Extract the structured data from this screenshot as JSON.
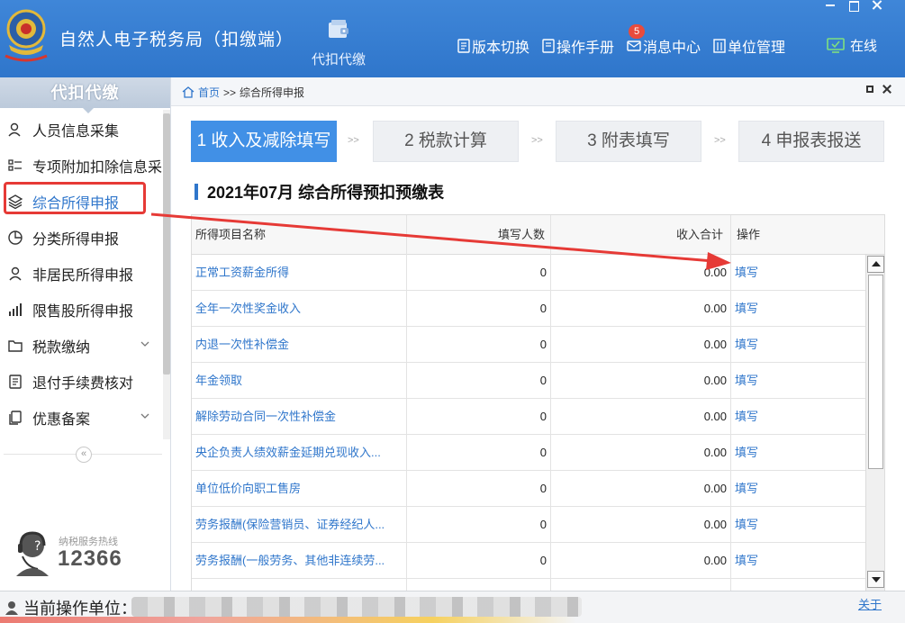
{
  "app": {
    "title": "自然人电子税务局（扣缴端）",
    "center_tab": "代扣代缴",
    "nav_links": [
      {
        "label": "版本切换",
        "icon": "document-icon"
      },
      {
        "label": "操作手册",
        "icon": "manual-icon"
      },
      {
        "label": "消息中心",
        "icon": "mail-icon",
        "badge": "5"
      },
      {
        "label": "单位管理",
        "icon": "building-icon"
      }
    ],
    "status": "在线"
  },
  "sidebar": {
    "header": "代扣代缴",
    "items": [
      {
        "label": "人员信息采集",
        "icon": "person-icon",
        "name": "sidebar-item-personnel"
      },
      {
        "label": "专项附加扣除信息采集",
        "icon": "list-icon",
        "name": "sidebar-item-special-deduction"
      },
      {
        "label": "综合所得申报",
        "icon": "layers-icon",
        "name": "sidebar-item-comprehensive",
        "active": true
      },
      {
        "label": "分类所得申报",
        "icon": "pie-icon",
        "name": "sidebar-item-classified"
      },
      {
        "label": "非居民所得申报",
        "icon": "person-icon",
        "name": "sidebar-item-nonresident"
      },
      {
        "label": "限售股所得申报",
        "icon": "bar-chart-icon",
        "name": "sidebar-item-restricted-shares"
      },
      {
        "label": "税款缴纳",
        "icon": "folder-icon",
        "name": "sidebar-item-tax-payment",
        "expandable": true
      },
      {
        "label": "退付手续费核对",
        "icon": "receipt-icon",
        "name": "sidebar-item-refund-fee"
      },
      {
        "label": "优惠备案",
        "icon": "copy-icon",
        "name": "sidebar-item-preferential",
        "expandable": true
      }
    ],
    "hotline_label": "纳税服务热线",
    "hotline_number": "12366"
  },
  "breadcrumb": {
    "home": "首页",
    "separator": ">>",
    "current": "综合所得申报"
  },
  "steps": [
    {
      "label": "1 收入及减除填写",
      "active": true
    },
    {
      "label": "2 税款计算",
      "active": false
    },
    {
      "label": "3 附表填写",
      "active": false
    },
    {
      "label": "4 申报表报送",
      "active": false
    }
  ],
  "step_separator": ">>",
  "table": {
    "title": "2021年07月  综合所得预扣预缴表",
    "columns": [
      "所得项目名称",
      "填写人数",
      "收入合计",
      "操作"
    ],
    "rows": [
      {
        "name": "正常工资薪金所得",
        "count": "0",
        "income": "0.00",
        "action": "填写"
      },
      {
        "name": "全年一次性奖金收入",
        "count": "0",
        "income": "0.00",
        "action": "填写"
      },
      {
        "name": "内退一次性补偿金",
        "count": "0",
        "income": "0.00",
        "action": "填写"
      },
      {
        "name": "年金领取",
        "count": "0",
        "income": "0.00",
        "action": "填写"
      },
      {
        "name": "解除劳动合同一次性补偿金",
        "count": "0",
        "income": "0.00",
        "action": "填写"
      },
      {
        "name": "央企负责人绩效薪金延期兑现收入...",
        "count": "0",
        "income": "0.00",
        "action": "填写"
      },
      {
        "name": "单位低价向职工售房",
        "count": "0",
        "income": "0.00",
        "action": "填写"
      },
      {
        "name": "劳务报酬(保险营销员、证券经纪人...",
        "count": "0",
        "income": "0.00",
        "action": "填写"
      },
      {
        "name": "劳务报酬(一般劳务、其他非连续劳...",
        "count": "0",
        "income": "0.00",
        "action": "填写"
      }
    ]
  },
  "statusbar": {
    "label": "当前操作单位：",
    "about": "关于"
  },
  "colors": {
    "brand_blue": "#2f76cb",
    "step_active": "#4190e6",
    "annotation_red": "#e63a36"
  }
}
